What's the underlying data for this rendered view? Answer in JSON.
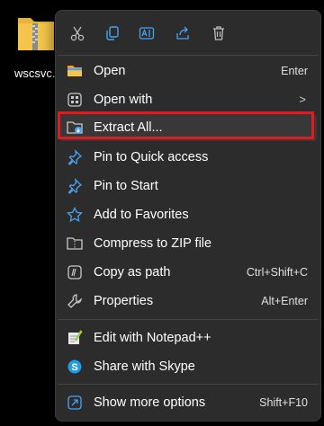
{
  "desktop": {
    "file_name": "wscsvc."
  },
  "toolbar": {
    "buttons": [
      {
        "name": "cut",
        "icon": "scissors-icon"
      },
      {
        "name": "copy",
        "icon": "copy-icon"
      },
      {
        "name": "rename",
        "icon": "rename-icon"
      },
      {
        "name": "share",
        "icon": "share-icon"
      },
      {
        "name": "delete",
        "icon": "trash-icon"
      }
    ]
  },
  "menu": {
    "open": {
      "label": "Open",
      "shortcut": "Enter"
    },
    "open_with": {
      "label": "Open with",
      "arrow": ">"
    },
    "extract_all": {
      "label": "Extract All..."
    },
    "pin_quick": {
      "label": "Pin to Quick access"
    },
    "pin_start": {
      "label": "Pin to Start"
    },
    "favorites": {
      "label": "Add to Favorites"
    },
    "compress": {
      "label": "Compress to ZIP file"
    },
    "copy_path": {
      "label": "Copy as path",
      "shortcut": "Ctrl+Shift+C"
    },
    "properties": {
      "label": "Properties",
      "shortcut": "Alt+Enter"
    },
    "notepad": {
      "label": "Edit with Notepad++"
    },
    "skype": {
      "label": "Share with Skype"
    },
    "more": {
      "label": "Show more options",
      "shortcut": "Shift+F10"
    }
  },
  "colors": {
    "menu_bg": "#2c2c2c",
    "accent_blue": "#4aa3f0",
    "highlight_red": "#e01b24",
    "folder_yellow": "#f4c54a"
  }
}
